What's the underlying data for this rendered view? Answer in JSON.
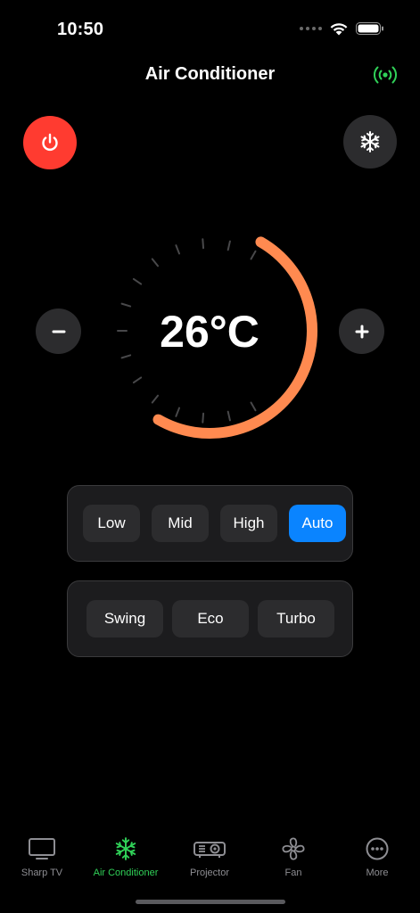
{
  "status": {
    "time": "10:50"
  },
  "header": {
    "title": "Air Conditioner"
  },
  "icons": {
    "power": "power-icon",
    "mode": "snowflake-icon",
    "connection": "broadcast-signal-icon"
  },
  "controls": {
    "decrease_label": "–",
    "increase_label": "+"
  },
  "temperature": {
    "value": 26,
    "unit": "°C",
    "display": "26°C",
    "level_fraction": 0.75
  },
  "fan_speed": {
    "options": [
      {
        "label": "Low"
      },
      {
        "label": "Mid"
      },
      {
        "label": "High"
      },
      {
        "label": "Auto"
      }
    ],
    "selected": "Auto"
  },
  "features": {
    "options": [
      {
        "label": "Swing"
      },
      {
        "label": "Eco"
      },
      {
        "label": "Turbo"
      }
    ]
  },
  "tabbar": {
    "items": [
      {
        "label": "Sharp TV",
        "icon": "tv-icon"
      },
      {
        "label": "Air Conditioner",
        "icon": "snowflake-icon"
      },
      {
        "label": "Projector",
        "icon": "projector-icon"
      },
      {
        "label": "Fan",
        "icon": "fan-icon"
      },
      {
        "label": "More",
        "icon": "more-icon"
      }
    ],
    "active": "Air Conditioner"
  },
  "colors": {
    "accent_orange": "#ff8a50",
    "power_red": "#ff3b30",
    "active_blue": "#0a84ff",
    "active_green": "#30d158",
    "track_gray": "#3a3a3c"
  }
}
